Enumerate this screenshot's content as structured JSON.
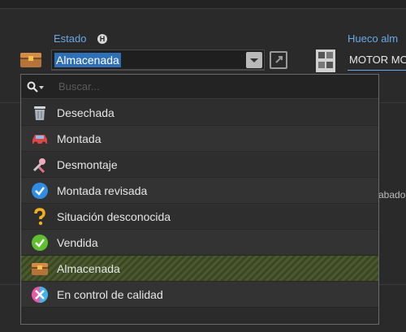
{
  "estado": {
    "label": "Estado",
    "badge": "H",
    "value": "Almacenada"
  },
  "hueco": {
    "label": "Hueco alm",
    "value": "MOTOR MO"
  },
  "background_fragment": "abado",
  "dropdown": {
    "search_placeholder": "Buscar...",
    "items": [
      {
        "label": "Desechada",
        "icon": "trash-icon"
      },
      {
        "label": "Montada",
        "icon": "car-icon"
      },
      {
        "label": "Desmontaje",
        "icon": "disassembly-icon"
      },
      {
        "label": "Montada revisada",
        "icon": "check-blue-icon"
      },
      {
        "label": "Situación desconocida",
        "icon": "question-icon"
      },
      {
        "label": "Vendida",
        "icon": "check-green-icon"
      },
      {
        "label": "Almacenada",
        "icon": "chest-icon",
        "selected": true
      },
      {
        "label": "En control de calidad",
        "icon": "quality-icon"
      }
    ]
  },
  "colors": {
    "accent_blue": "#6aa9e8",
    "selection_blue": "#2f6fb6",
    "selected_row_green": "#4a5a2e"
  }
}
